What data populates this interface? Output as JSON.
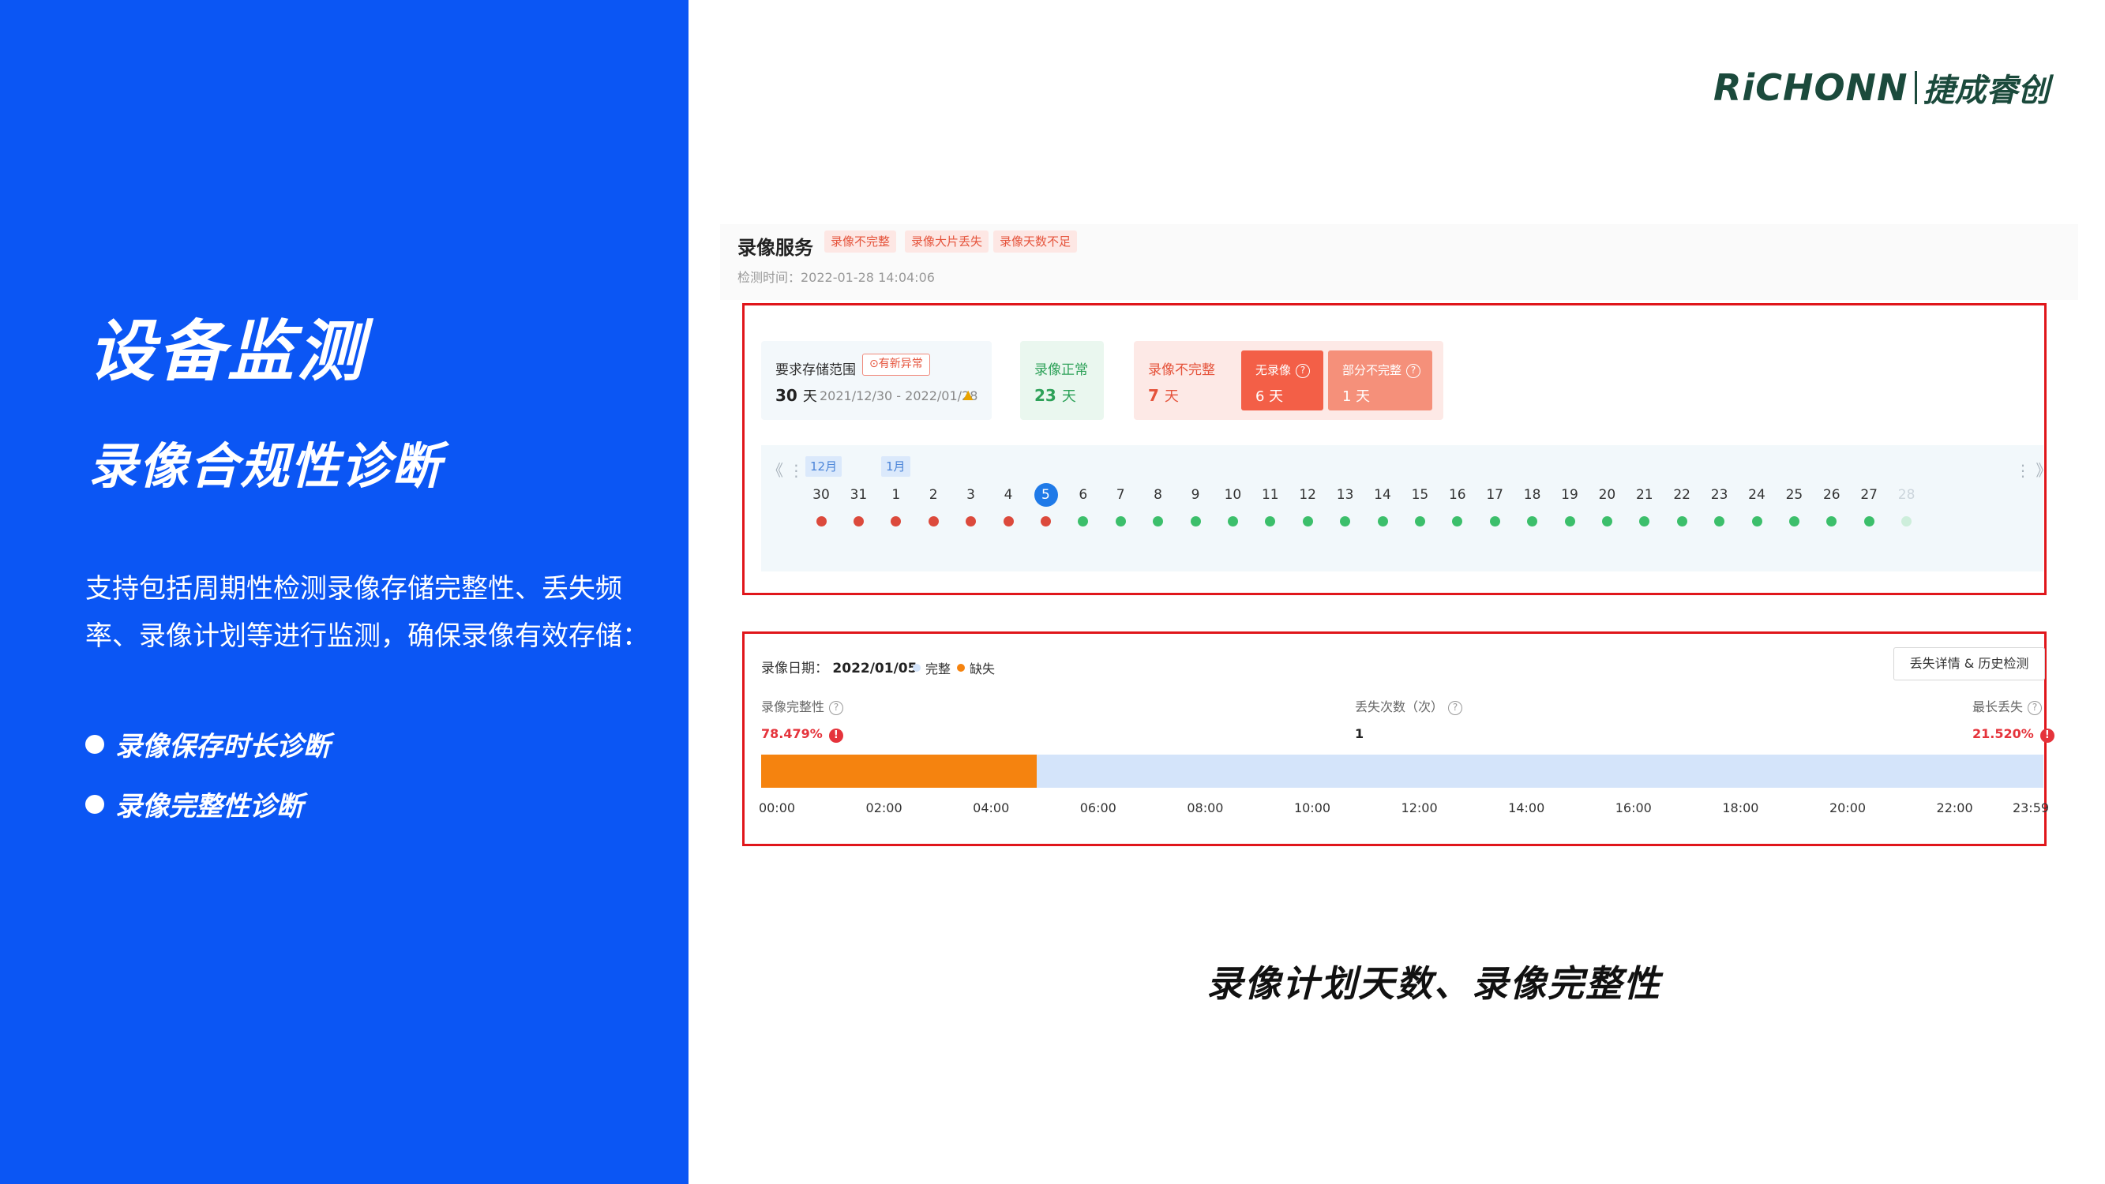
{
  "left": {
    "title": "设备监测",
    "subtitle": "录像合规性诊断",
    "description": "支持包括周期性检测录像存储完整性、丢失频率、录像计划等进行监测，确保录像有效存储：",
    "bullets": [
      "录像保存时长诊断",
      "录像完整性诊断"
    ]
  },
  "logo": {
    "en": "RiCHONN",
    "cn": "捷成睿创"
  },
  "service": {
    "title": "录像服务",
    "tags": [
      "录像不完整",
      "录像大片丢失",
      "录像天数不足"
    ],
    "check_time": "检测时间：2022-01-28 14:04:06"
  },
  "stats": {
    "range_label": "要求存储范围",
    "anomaly_badge": "⊙有新异常",
    "range_value": "30",
    "range_unit": "天",
    "range_dates": "2021/12/30 - 2022/01/28",
    "normal_label": "录像正常",
    "normal_value": "23",
    "normal_unit": "天",
    "incomplete_label": "录像不完整",
    "incomplete_value": "7",
    "incomplete_unit": "天",
    "no_record_label": "无录像",
    "no_record_value": "6 天",
    "partial_label": "部分不完整",
    "partial_value": "1 天"
  },
  "calendar": {
    "months": [
      "12月",
      "1月"
    ],
    "nav_prev": "《 ⋮",
    "nav_next": "⋮ 》",
    "today": "5",
    "days": [
      {
        "d": "30",
        "s": "red"
      },
      {
        "d": "31",
        "s": "red"
      },
      {
        "d": "1",
        "s": "red"
      },
      {
        "d": "2",
        "s": "red"
      },
      {
        "d": "3",
        "s": "red"
      },
      {
        "d": "4",
        "s": "red"
      },
      {
        "d": "5",
        "s": "red"
      },
      {
        "d": "6",
        "s": "green"
      },
      {
        "d": "7",
        "s": "green"
      },
      {
        "d": "8",
        "s": "green"
      },
      {
        "d": "9",
        "s": "green"
      },
      {
        "d": "10",
        "s": "green"
      },
      {
        "d": "11",
        "s": "green"
      },
      {
        "d": "12",
        "s": "green"
      },
      {
        "d": "13",
        "s": "green"
      },
      {
        "d": "14",
        "s": "green"
      },
      {
        "d": "15",
        "s": "green"
      },
      {
        "d": "16",
        "s": "green"
      },
      {
        "d": "17",
        "s": "green"
      },
      {
        "d": "18",
        "s": "green"
      },
      {
        "d": "19",
        "s": "green"
      },
      {
        "d": "20",
        "s": "green"
      },
      {
        "d": "21",
        "s": "green"
      },
      {
        "d": "22",
        "s": "green"
      },
      {
        "d": "23",
        "s": "green"
      },
      {
        "d": "24",
        "s": "green"
      },
      {
        "d": "25",
        "s": "green"
      },
      {
        "d": "26",
        "s": "green"
      },
      {
        "d": "27",
        "s": "green"
      },
      {
        "d": "28",
        "s": "pending"
      }
    ],
    "colors": {
      "red": "#dc4a3c",
      "green": "#3cbf6b",
      "pending": "#cdeedb"
    }
  },
  "detail": {
    "date_label": "录像日期：",
    "date_value": "2022/01/05",
    "legend_complete": "完整",
    "legend_missing": "缺失",
    "history_button": "丢失详情 & 历史检测",
    "integrity_label": "录像完整性",
    "integrity_value": "78.479%",
    "loss_count_label": "丢失次数（次）",
    "loss_count_value": "1",
    "longest_loss_label": "最长丢失",
    "longest_loss_value": "21.520%",
    "timeline_fill_fraction": 0.215,
    "ticks": [
      "00:00",
      "02:00",
      "04:00",
      "06:00",
      "08:00",
      "10:00",
      "12:00",
      "14:00",
      "16:00",
      "18:00",
      "20:00",
      "22:00",
      "23:59"
    ],
    "colors": {
      "complete": "#d4e4fa",
      "missing": "#f5830f"
    }
  },
  "caption": "录像计划天数、录像完整性"
}
